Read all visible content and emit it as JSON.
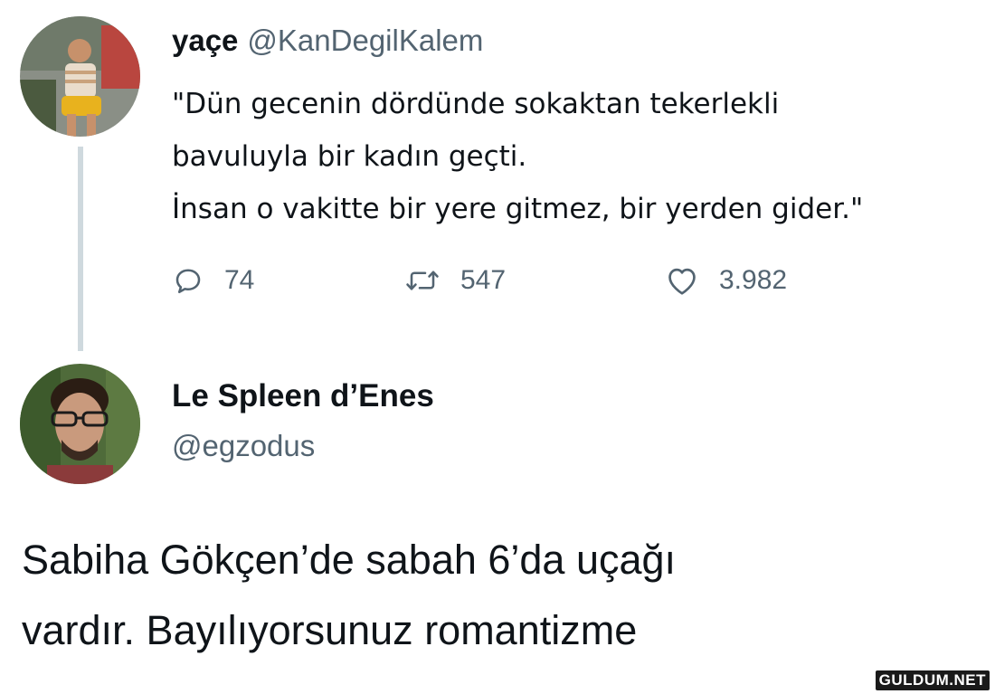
{
  "tweet1": {
    "display_name": "yaçe",
    "handle": "@KanDegilKalem",
    "text_lines": [
      "\"Dün gecenin dördünde sokaktan tekerlekli",
      "bavuluyla bir kadın geçti.",
      "İnsan o vakitte bir yere gitmez, bir yerden gider.\""
    ],
    "actions": {
      "reply_count": "74",
      "retweet_count": "547",
      "like_count": "3.982"
    }
  },
  "tweet2": {
    "display_name": "Le Spleen d’Enes",
    "handle": "@egzodus",
    "text_lines": [
      "Sabiha Gökçen’de sabah 6’da uçağı",
      "vardır. Bayılıyorsunuz romantizme"
    ]
  },
  "watermark": "GULDUM.NET",
  "icons": {
    "reply": "reply-icon",
    "retweet": "retweet-icon",
    "like": "heart-icon"
  },
  "colors": {
    "text": "#0f1419",
    "secondary": "#536471",
    "thread_line": "#cfd9de"
  }
}
